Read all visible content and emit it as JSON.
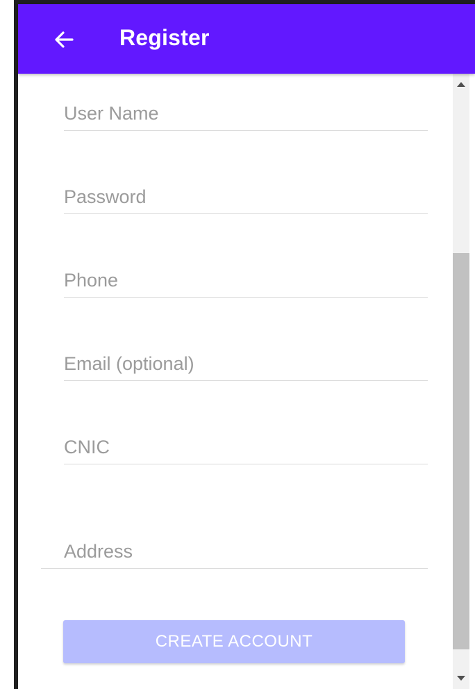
{
  "app_bar": {
    "title": "Register",
    "background_color": "#6218ff",
    "back_icon": "arrow-left-icon"
  },
  "form": {
    "fields": [
      {
        "placeholder": "User Name",
        "value": ""
      },
      {
        "placeholder": "Password",
        "value": ""
      },
      {
        "placeholder": "Phone",
        "value": ""
      },
      {
        "placeholder": "Email (optional)",
        "value": ""
      },
      {
        "placeholder": "CNIC",
        "value": ""
      },
      {
        "placeholder": "Address",
        "value": ""
      }
    ],
    "submit_label": "CREATE ACCOUNT",
    "submit_color": "#b6bcfe"
  },
  "scrollbar": {
    "up_icon": "scroll-up-arrow-icon",
    "down_icon": "scroll-down-arrow-icon"
  }
}
